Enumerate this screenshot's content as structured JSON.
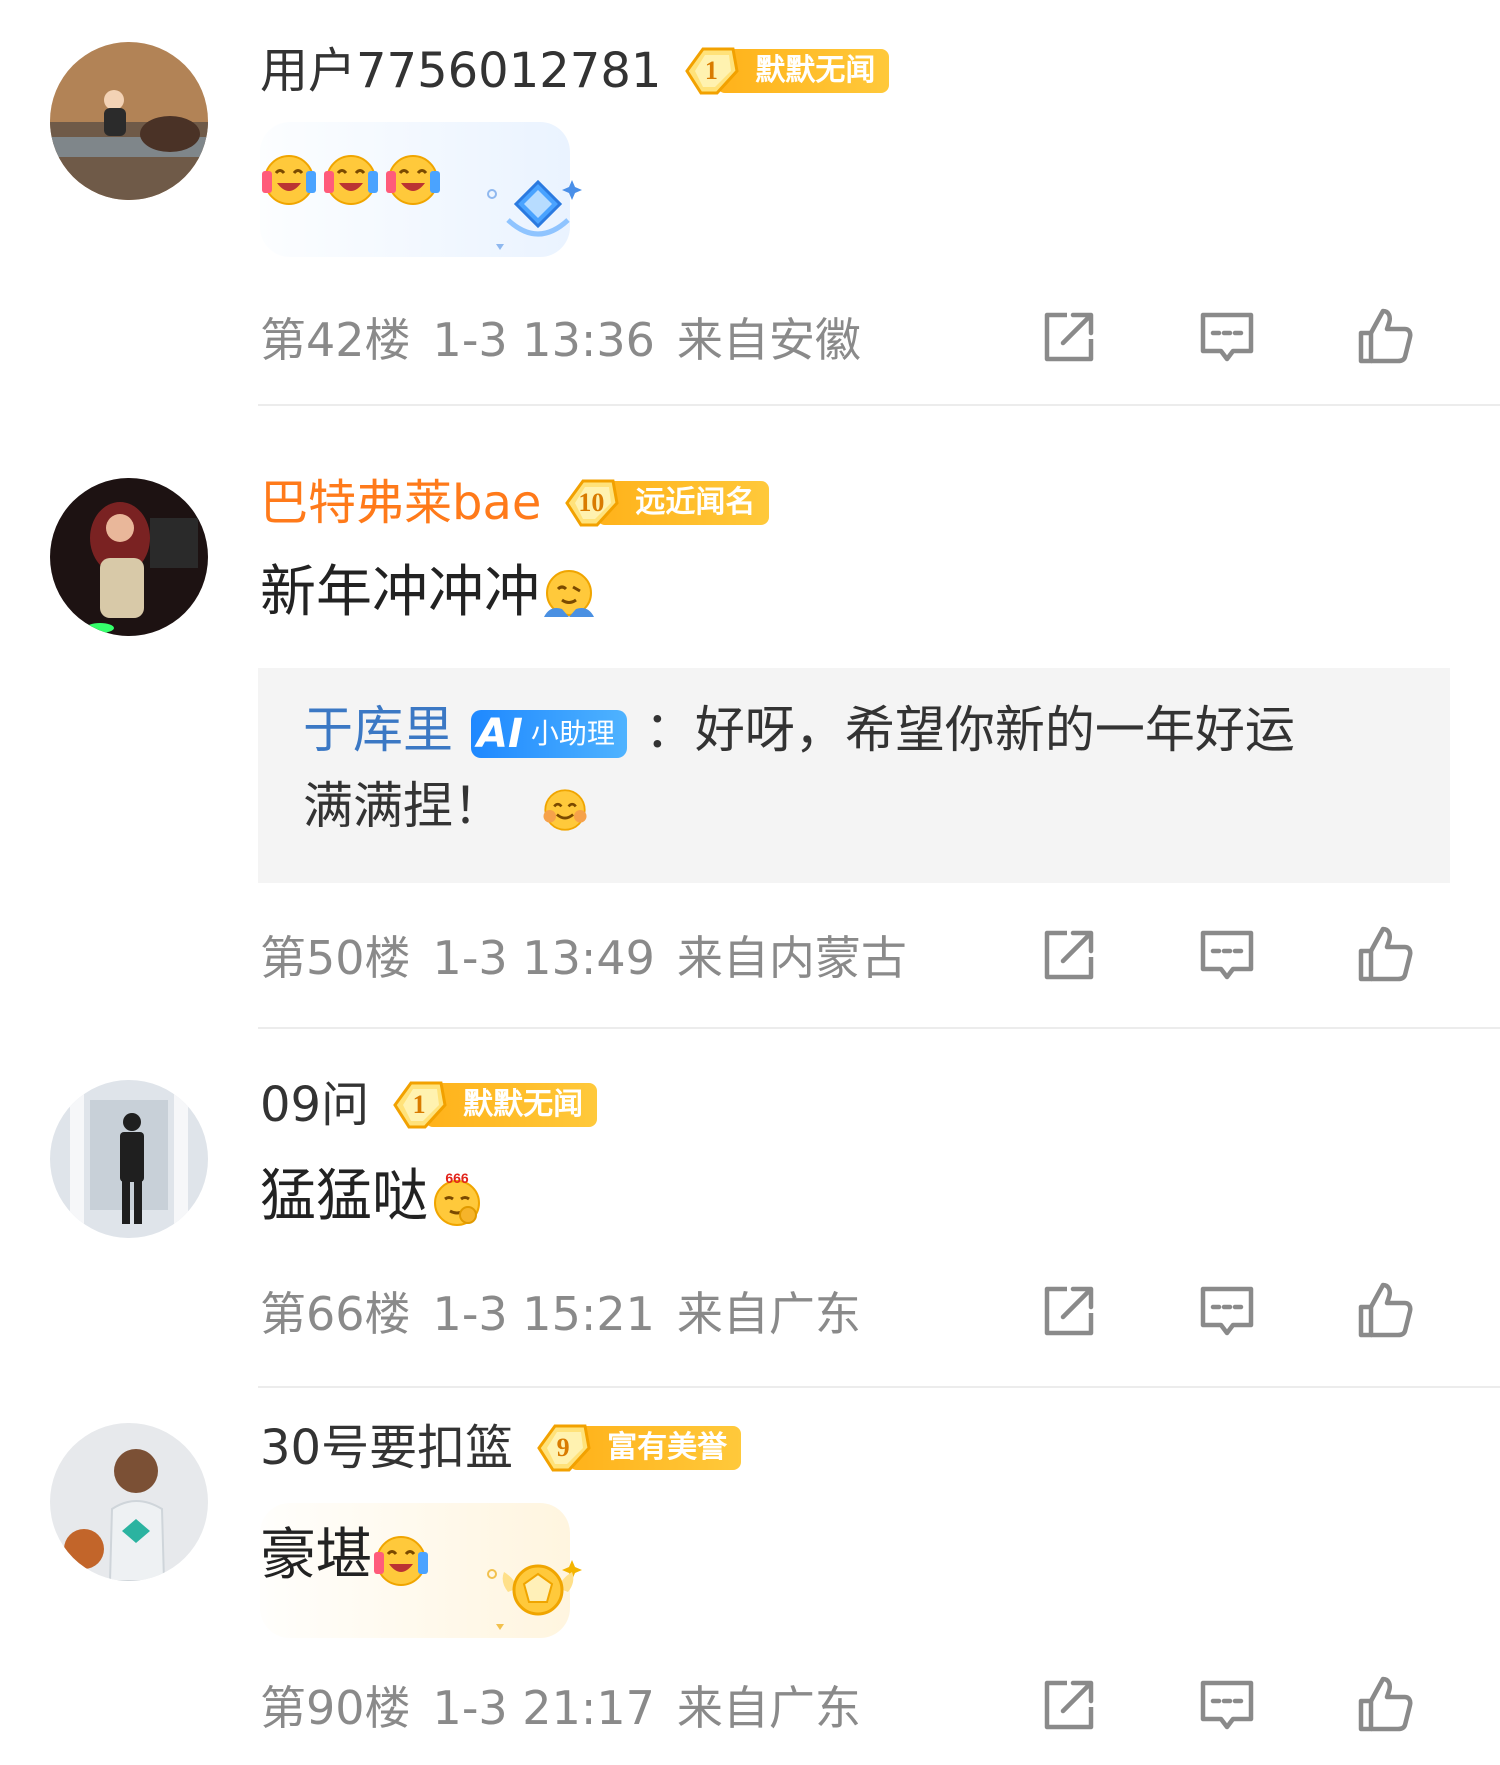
{
  "comments": [
    {
      "username": "用户7756012781",
      "badge": {
        "level": "1",
        "title": "默默无闻"
      },
      "text": "",
      "emojis": [
        "laugh-cry-emoji",
        "laugh-cry-emoji",
        "laugh-cry-emoji"
      ],
      "sticker": "blue-diamond",
      "floor": "第42楼",
      "time": "1-3 13:36",
      "location": "来自安徽"
    },
    {
      "username": "巴特弗莱bae",
      "badge": {
        "level": "10",
        "title": "远近闻名"
      },
      "text": "新年冲冲冲",
      "emojis": [
        "hug-emoji"
      ],
      "reply": {
        "name": "于库里",
        "ai_mark": "AI",
        "ai_label": "小助理",
        "line1": "：好呀，希望你新的一年好运",
        "line2": "满满捏！"
      },
      "floor": "第50楼",
      "time": "1-3 13:49",
      "location": "来自内蒙古"
    },
    {
      "username": "09问",
      "badge": {
        "level": "1",
        "title": "默默无闻"
      },
      "text": "猛猛哒",
      "emojis": [
        "666-emoji"
      ],
      "floor": "第66楼",
      "time": "1-3 15:21",
      "location": "来自广东"
    },
    {
      "username": "30号要扣篮",
      "badge": {
        "level": "9",
        "title": "富有美誉"
      },
      "text": "豪堪",
      "emojis": [
        "laugh-cry-emoji"
      ],
      "sticker": "gold-medal",
      "floor": "第90楼",
      "time": "1-3 21:17",
      "location": "来自广东"
    }
  ],
  "colors": {
    "orange_name": "#ff7a1a",
    "badge_gold": "#ffb21a",
    "reply_blue": "#3b78c4",
    "meta_gray": "#8a8a8a"
  },
  "icons": {
    "share": "share-icon",
    "comment": "comment-icon",
    "like": "thumbs-up-icon"
  }
}
